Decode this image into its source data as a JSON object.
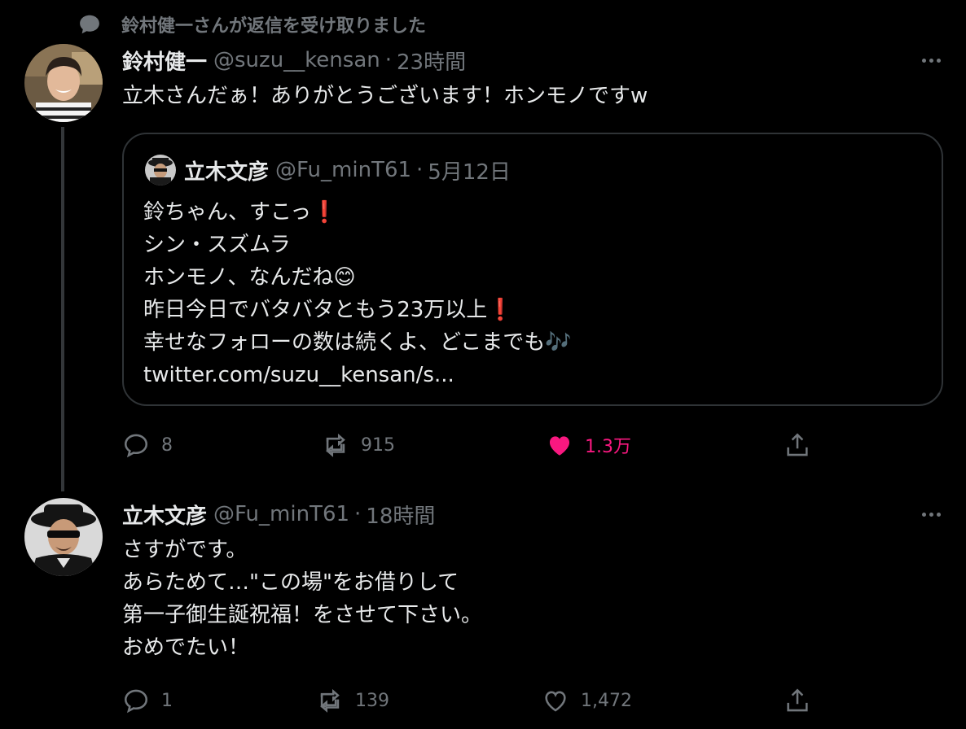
{
  "social_context": {
    "text": "鈴村健一さんが返信を受け取りました",
    "icon": "speech-bubble-icon"
  },
  "tweets": [
    {
      "name": "鈴村健一",
      "handle": "@suzu__kensan",
      "separator": "·",
      "time": "23時間",
      "text": "立木さんだぁ！ありがとうございます！ホンモノですw",
      "quote": {
        "name": "立木文彦",
        "handle": "@Fu_minT61",
        "separator": "·",
        "time": "5月12日",
        "lines": [
          {
            "text": "鈴ちゃん、すこっ",
            "emoji": "❗"
          },
          {
            "text": "シン・スズムラ",
            "emoji": ""
          },
          {
            "text": "ホンモノ、なんだね",
            "emoji": "😊"
          },
          {
            "text": "昨日今日でバタバタともう23万以上",
            "emoji": "❗"
          },
          {
            "text": "幸せなフォローの数は続くよ、どこまでも",
            "emoji": "🎶"
          },
          {
            "text": "twitter.com/suzu__kensan/s...",
            "emoji": ""
          }
        ]
      },
      "actions": {
        "reply_count": "8",
        "retweet_count": "915",
        "like_count": "1.3万",
        "liked": true
      }
    },
    {
      "name": "立木文彦",
      "handle": "@Fu_minT61",
      "separator": "·",
      "time": "18時間",
      "text": "さすがです。\nあらためて…\"この場\"をお借りして\n第一子御生誕祝福！をさせて下さい。\nおめでたい！",
      "actions": {
        "reply_count": "1",
        "retweet_count": "139",
        "like_count": "1,472",
        "liked": false
      }
    }
  ],
  "colors": {
    "background": "#000000",
    "text_primary": "#e7e9ea",
    "text_secondary": "#71767b",
    "like_pink": "#f91880",
    "border": "#2f3336"
  }
}
